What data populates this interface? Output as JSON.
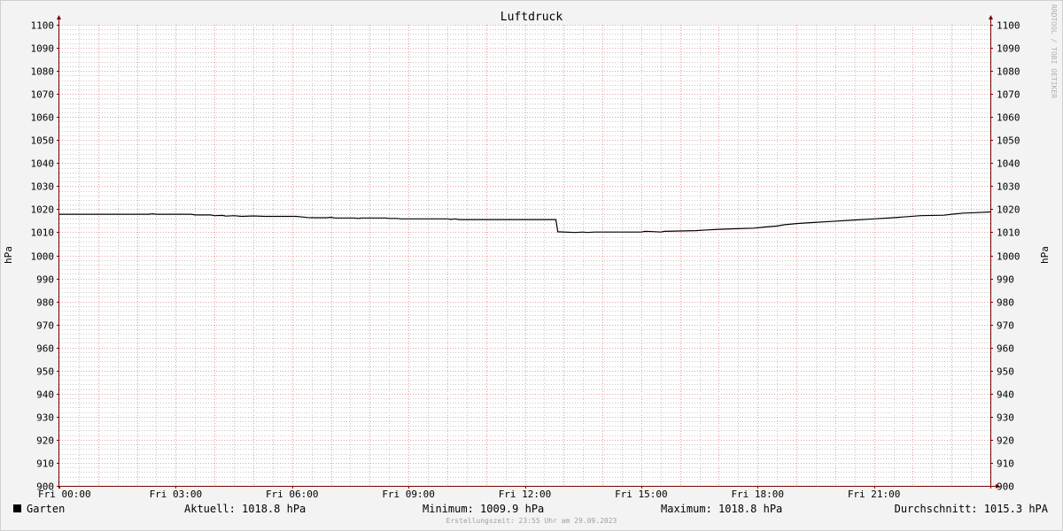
{
  "chart_data": {
    "type": "line",
    "title": "Luftdruck",
    "ylabel": "hPa",
    "ylabel_right": "hPa",
    "ylim": [
      900,
      1100
    ],
    "y_ticks": [
      900,
      910,
      920,
      930,
      940,
      950,
      960,
      970,
      980,
      990,
      1000,
      1010,
      1020,
      1030,
      1040,
      1050,
      1060,
      1070,
      1080,
      1090,
      1100
    ],
    "xlim": [
      0,
      24
    ],
    "x_ticks": [
      {
        "hour": 0,
        "label": "Fri 00:00"
      },
      {
        "hour": 3,
        "label": "Fri 03:00"
      },
      {
        "hour": 6,
        "label": "Fri 06:00"
      },
      {
        "hour": 9,
        "label": "Fri 09:00"
      },
      {
        "hour": 12,
        "label": "Fri 12:00"
      },
      {
        "hour": 15,
        "label": "Fri 15:00"
      },
      {
        "hour": 18,
        "label": "Fri 18:00"
      },
      {
        "hour": 21,
        "label": "Fri 21:00"
      }
    ],
    "grid": true,
    "series": [
      {
        "name": "Garten",
        "color": "#000000",
        "points": [
          [
            0.0,
            1017.8
          ],
          [
            2.3,
            1017.8
          ],
          [
            2.4,
            1018.0
          ],
          [
            2.5,
            1017.8
          ],
          [
            3.4,
            1017.8
          ],
          [
            3.5,
            1017.5
          ],
          [
            3.9,
            1017.5
          ],
          [
            4.0,
            1017.2
          ],
          [
            4.2,
            1017.3
          ],
          [
            4.3,
            1017.0
          ],
          [
            4.5,
            1017.2
          ],
          [
            4.7,
            1016.9
          ],
          [
            5.0,
            1017.1
          ],
          [
            5.3,
            1016.9
          ],
          [
            6.1,
            1016.9
          ],
          [
            6.3,
            1016.6
          ],
          [
            6.4,
            1016.4
          ],
          [
            6.5,
            1016.3
          ],
          [
            6.9,
            1016.3
          ],
          [
            7.0,
            1016.5
          ],
          [
            7.1,
            1016.2
          ],
          [
            7.6,
            1016.2
          ],
          [
            7.7,
            1016.0
          ],
          [
            7.8,
            1016.2
          ],
          [
            8.4,
            1016.2
          ],
          [
            8.5,
            1016.0
          ],
          [
            8.7,
            1016.0
          ],
          [
            8.8,
            1015.8
          ],
          [
            10.0,
            1015.8
          ],
          [
            10.1,
            1015.6
          ],
          [
            10.2,
            1015.8
          ],
          [
            10.3,
            1015.5
          ],
          [
            12.8,
            1015.5
          ],
          [
            12.85,
            1010.2
          ],
          [
            13.3,
            1009.9
          ],
          [
            13.5,
            1010.1
          ],
          [
            13.6,
            1009.9
          ],
          [
            13.8,
            1010.1
          ],
          [
            15.0,
            1010.1
          ],
          [
            15.1,
            1010.4
          ],
          [
            15.3,
            1010.3
          ],
          [
            15.5,
            1010.1
          ],
          [
            15.6,
            1010.4
          ],
          [
            16.4,
            1010.7
          ],
          [
            16.7,
            1011.0
          ],
          [
            17.0,
            1011.3
          ],
          [
            17.4,
            1011.5
          ],
          [
            17.9,
            1011.8
          ],
          [
            18.2,
            1012.3
          ],
          [
            18.5,
            1012.7
          ],
          [
            18.7,
            1013.3
          ],
          [
            19.0,
            1013.8
          ],
          [
            19.4,
            1014.2
          ],
          [
            19.9,
            1014.7
          ],
          [
            20.5,
            1015.3
          ],
          [
            21.0,
            1015.8
          ],
          [
            21.5,
            1016.3
          ],
          [
            21.9,
            1016.8
          ],
          [
            22.2,
            1017.2
          ],
          [
            22.8,
            1017.4
          ],
          [
            23.0,
            1017.8
          ],
          [
            23.3,
            1018.3
          ],
          [
            23.6,
            1018.5
          ],
          [
            24.0,
            1018.8
          ]
        ]
      }
    ]
  },
  "legend": {
    "name": "Garten",
    "color": "#000000",
    "current": "Aktuell: 1018.8 hPa",
    "minimum": "Minimum: 1009.9 hPa",
    "maximum": "Maximum: 1018.8 hPa",
    "average": "Durchschnitt: 1015.3 hPA"
  },
  "footer": "Erstellungszeit: 23:55 Uhr am 29.09.2023",
  "watermark": "RRDTOOL / TOBI OETIKER",
  "colors": {
    "background": "#f3f3f3",
    "plot_background": "#ffffff",
    "major_grid": "#e6a0a0",
    "minor_grid": "#c8c8c8",
    "axis": "#7a0000",
    "line": "#000000"
  }
}
